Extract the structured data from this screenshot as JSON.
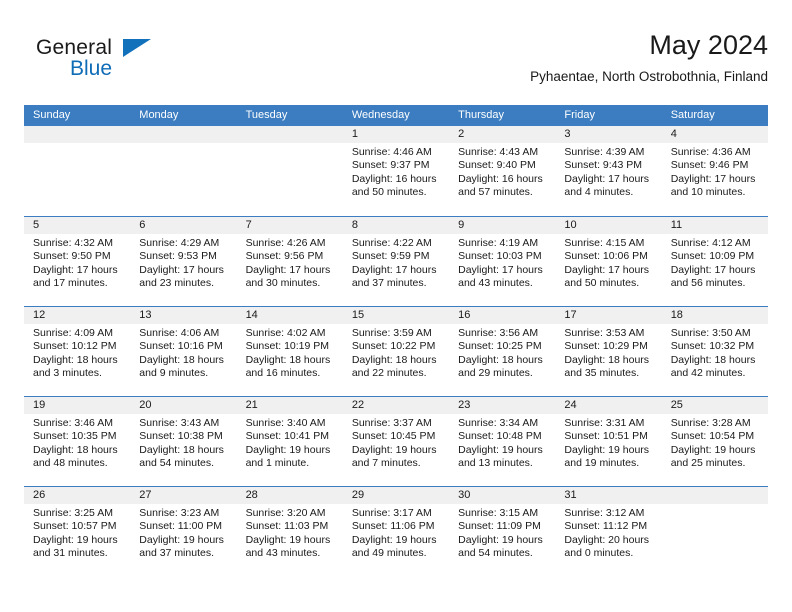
{
  "brand": {
    "line1": "General",
    "line2": "Blue",
    "accent_color": "#1271bb"
  },
  "header": {
    "title": "May 2024",
    "subtitle": "Pyhaentae, North Ostrobothnia, Finland"
  },
  "calendar": {
    "header_bg": "#3b7dc0",
    "daynum_bg": "#f0f0f0",
    "weekdays": [
      "Sunday",
      "Monday",
      "Tuesday",
      "Wednesday",
      "Thursday",
      "Friday",
      "Saturday"
    ],
    "labels": {
      "sunrise": "Sunrise:",
      "sunset": "Sunset:",
      "daylight": "Daylight:"
    },
    "weeks": [
      [
        {
          "day": "",
          "sunrise": "",
          "sunset": "",
          "daylight1": "",
          "daylight2": ""
        },
        {
          "day": "",
          "sunrise": "",
          "sunset": "",
          "daylight1": "",
          "daylight2": ""
        },
        {
          "day": "",
          "sunrise": "",
          "sunset": "",
          "daylight1": "",
          "daylight2": ""
        },
        {
          "day": "1",
          "sunrise": "Sunrise: 4:46 AM",
          "sunset": "Sunset: 9:37 PM",
          "daylight1": "Daylight: 16 hours",
          "daylight2": "and 50 minutes."
        },
        {
          "day": "2",
          "sunrise": "Sunrise: 4:43 AM",
          "sunset": "Sunset: 9:40 PM",
          "daylight1": "Daylight: 16 hours",
          "daylight2": "and 57 minutes."
        },
        {
          "day": "3",
          "sunrise": "Sunrise: 4:39 AM",
          "sunset": "Sunset: 9:43 PM",
          "daylight1": "Daylight: 17 hours",
          "daylight2": "and 4 minutes."
        },
        {
          "day": "4",
          "sunrise": "Sunrise: 4:36 AM",
          "sunset": "Sunset: 9:46 PM",
          "daylight1": "Daylight: 17 hours",
          "daylight2": "and 10 minutes."
        }
      ],
      [
        {
          "day": "5",
          "sunrise": "Sunrise: 4:32 AM",
          "sunset": "Sunset: 9:50 PM",
          "daylight1": "Daylight: 17 hours",
          "daylight2": "and 17 minutes."
        },
        {
          "day": "6",
          "sunrise": "Sunrise: 4:29 AM",
          "sunset": "Sunset: 9:53 PM",
          "daylight1": "Daylight: 17 hours",
          "daylight2": "and 23 minutes."
        },
        {
          "day": "7",
          "sunrise": "Sunrise: 4:26 AM",
          "sunset": "Sunset: 9:56 PM",
          "daylight1": "Daylight: 17 hours",
          "daylight2": "and 30 minutes."
        },
        {
          "day": "8",
          "sunrise": "Sunrise: 4:22 AM",
          "sunset": "Sunset: 9:59 PM",
          "daylight1": "Daylight: 17 hours",
          "daylight2": "and 37 minutes."
        },
        {
          "day": "9",
          "sunrise": "Sunrise: 4:19 AM",
          "sunset": "Sunset: 10:03 PM",
          "daylight1": "Daylight: 17 hours",
          "daylight2": "and 43 minutes."
        },
        {
          "day": "10",
          "sunrise": "Sunrise: 4:15 AM",
          "sunset": "Sunset: 10:06 PM",
          "daylight1": "Daylight: 17 hours",
          "daylight2": "and 50 minutes."
        },
        {
          "day": "11",
          "sunrise": "Sunrise: 4:12 AM",
          "sunset": "Sunset: 10:09 PM",
          "daylight1": "Daylight: 17 hours",
          "daylight2": "and 56 minutes."
        }
      ],
      [
        {
          "day": "12",
          "sunrise": "Sunrise: 4:09 AM",
          "sunset": "Sunset: 10:12 PM",
          "daylight1": "Daylight: 18 hours",
          "daylight2": "and 3 minutes."
        },
        {
          "day": "13",
          "sunrise": "Sunrise: 4:06 AM",
          "sunset": "Sunset: 10:16 PM",
          "daylight1": "Daylight: 18 hours",
          "daylight2": "and 9 minutes."
        },
        {
          "day": "14",
          "sunrise": "Sunrise: 4:02 AM",
          "sunset": "Sunset: 10:19 PM",
          "daylight1": "Daylight: 18 hours",
          "daylight2": "and 16 minutes."
        },
        {
          "day": "15",
          "sunrise": "Sunrise: 3:59 AM",
          "sunset": "Sunset: 10:22 PM",
          "daylight1": "Daylight: 18 hours",
          "daylight2": "and 22 minutes."
        },
        {
          "day": "16",
          "sunrise": "Sunrise: 3:56 AM",
          "sunset": "Sunset: 10:25 PM",
          "daylight1": "Daylight: 18 hours",
          "daylight2": "and 29 minutes."
        },
        {
          "day": "17",
          "sunrise": "Sunrise: 3:53 AM",
          "sunset": "Sunset: 10:29 PM",
          "daylight1": "Daylight: 18 hours",
          "daylight2": "and 35 minutes."
        },
        {
          "day": "18",
          "sunrise": "Sunrise: 3:50 AM",
          "sunset": "Sunset: 10:32 PM",
          "daylight1": "Daylight: 18 hours",
          "daylight2": "and 42 minutes."
        }
      ],
      [
        {
          "day": "19",
          "sunrise": "Sunrise: 3:46 AM",
          "sunset": "Sunset: 10:35 PM",
          "daylight1": "Daylight: 18 hours",
          "daylight2": "and 48 minutes."
        },
        {
          "day": "20",
          "sunrise": "Sunrise: 3:43 AM",
          "sunset": "Sunset: 10:38 PM",
          "daylight1": "Daylight: 18 hours",
          "daylight2": "and 54 minutes."
        },
        {
          "day": "21",
          "sunrise": "Sunrise: 3:40 AM",
          "sunset": "Sunset: 10:41 PM",
          "daylight1": "Daylight: 19 hours",
          "daylight2": "and 1 minute."
        },
        {
          "day": "22",
          "sunrise": "Sunrise: 3:37 AM",
          "sunset": "Sunset: 10:45 PM",
          "daylight1": "Daylight: 19 hours",
          "daylight2": "and 7 minutes."
        },
        {
          "day": "23",
          "sunrise": "Sunrise: 3:34 AM",
          "sunset": "Sunset: 10:48 PM",
          "daylight1": "Daylight: 19 hours",
          "daylight2": "and 13 minutes."
        },
        {
          "day": "24",
          "sunrise": "Sunrise: 3:31 AM",
          "sunset": "Sunset: 10:51 PM",
          "daylight1": "Daylight: 19 hours",
          "daylight2": "and 19 minutes."
        },
        {
          "day": "25",
          "sunrise": "Sunrise: 3:28 AM",
          "sunset": "Sunset: 10:54 PM",
          "daylight1": "Daylight: 19 hours",
          "daylight2": "and 25 minutes."
        }
      ],
      [
        {
          "day": "26",
          "sunrise": "Sunrise: 3:25 AM",
          "sunset": "Sunset: 10:57 PM",
          "daylight1": "Daylight: 19 hours",
          "daylight2": "and 31 minutes."
        },
        {
          "day": "27",
          "sunrise": "Sunrise: 3:23 AM",
          "sunset": "Sunset: 11:00 PM",
          "daylight1": "Daylight: 19 hours",
          "daylight2": "and 37 minutes."
        },
        {
          "day": "28",
          "sunrise": "Sunrise: 3:20 AM",
          "sunset": "Sunset: 11:03 PM",
          "daylight1": "Daylight: 19 hours",
          "daylight2": "and 43 minutes."
        },
        {
          "day": "29",
          "sunrise": "Sunrise: 3:17 AM",
          "sunset": "Sunset: 11:06 PM",
          "daylight1": "Daylight: 19 hours",
          "daylight2": "and 49 minutes."
        },
        {
          "day": "30",
          "sunrise": "Sunrise: 3:15 AM",
          "sunset": "Sunset: 11:09 PM",
          "daylight1": "Daylight: 19 hours",
          "daylight2": "and 54 minutes."
        },
        {
          "day": "31",
          "sunrise": "Sunrise: 3:12 AM",
          "sunset": "Sunset: 11:12 PM",
          "daylight1": "Daylight: 20 hours",
          "daylight2": "and 0 minutes."
        },
        {
          "day": "",
          "sunrise": "",
          "sunset": "",
          "daylight1": "",
          "daylight2": ""
        }
      ]
    ]
  }
}
